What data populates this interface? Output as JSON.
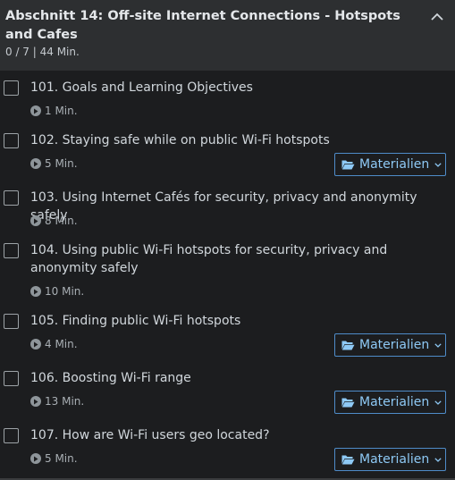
{
  "section": {
    "title": "Abschnitt 14: Off-site Internet Connections - Hotspots and Cafes",
    "meta": "0 / 7 | 44 Min."
  },
  "materials_label": "Materialien",
  "lectures": [
    {
      "title": "101. Goals and Learning Objectives",
      "duration": "1 Min.",
      "has_materials": false
    },
    {
      "title": "102. Staying safe while on public Wi-Fi hotspots",
      "duration": "5 Min.",
      "has_materials": true
    },
    {
      "title": "103. Using Internet Cafés for security, privacy and anonymity safely",
      "duration": "8 Min.",
      "has_materials": false
    },
    {
      "title": "104. Using public Wi-Fi hotspots for security, privacy and anonymity safely",
      "duration": "10 Min.",
      "has_materials": false
    },
    {
      "title": "105. Finding public Wi-Fi hotspots",
      "duration": "4 Min.",
      "has_materials": true
    },
    {
      "title": "106. Boosting Wi-Fi range",
      "duration": "13 Min.",
      "has_materials": true
    },
    {
      "title": "107. How are Wi-Fi users geo located?",
      "duration": "5 Min.",
      "has_materials": true
    }
  ],
  "icons": {
    "collapse": "chevron-up-icon",
    "play": "play-circle-icon",
    "folder": "folder-open-icon",
    "dropdown": "chevron-down-icon"
  },
  "colors": {
    "background": "#1c1d1f",
    "header_background": "#2d2f31",
    "accent": "#8ec9f5",
    "accent_border": "#4f8cc9"
  }
}
